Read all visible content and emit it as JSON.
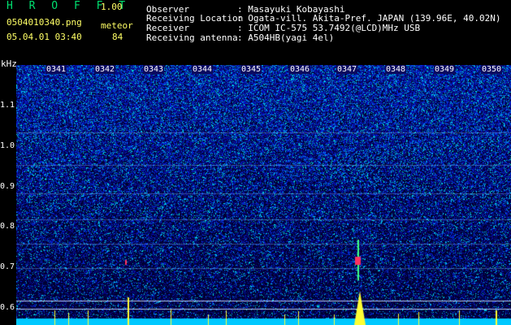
{
  "header": {
    "app_name": "H R O F F T",
    "version": "1.00",
    "filename": "0504010340.png",
    "datetime": "05.04.01 03:40",
    "meteor_label": "meteor",
    "meteor_count": "84"
  },
  "info": {
    "observer_label": "Observer",
    "observer_value": ": Masayuki Kobayashi",
    "location_label": "Receiving Location",
    "location_value": ": Ogata-vill. Akita-Pref. JAPAN (139.96E, 40.02N)",
    "receiver_label": "Receiver",
    "receiver_value": ": ICOM IC-575 53.7492(@LCD)MHz USB",
    "antenna_label": "Receiving antenna",
    "antenna_value": ": A504HB(yagi 4el)"
  },
  "spectrogram": {
    "y_unit": "kHz",
    "y_ticks": [
      "1.1",
      "1.0",
      "0.9",
      "0.8",
      "0.7",
      "0.6"
    ],
    "time_ticks": [
      "0341",
      "0342",
      "0343",
      "0344",
      "0345",
      "0346",
      "0347",
      "0348",
      "0349",
      "0350"
    ]
  }
}
